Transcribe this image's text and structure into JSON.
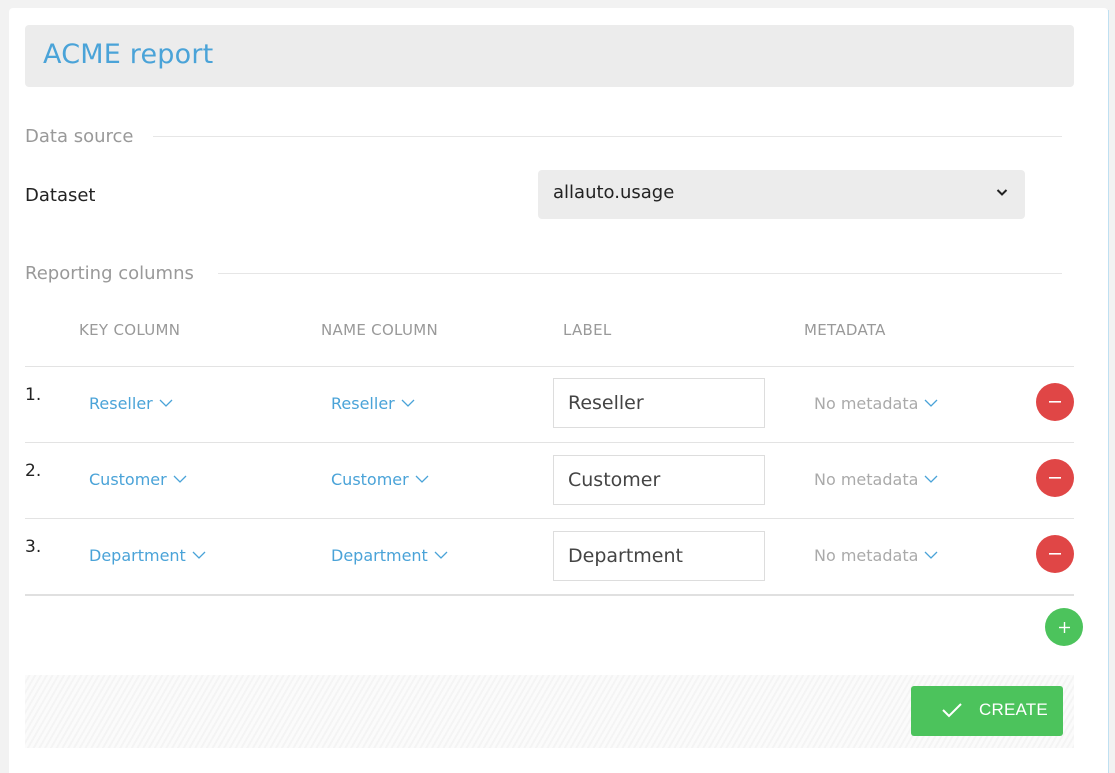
{
  "header": {
    "title": "ACME report"
  },
  "data_source": {
    "section_title": "Data source",
    "dataset_label": "Dataset",
    "dataset_value": "allauto.usage"
  },
  "reporting": {
    "section_title": "Reporting columns",
    "columns": {
      "key": "KEY COLUMN",
      "name": "NAME COLUMN",
      "label": "LABEL",
      "metadata": "METADATA"
    },
    "rows": [
      {
        "num": "1.",
        "key": "Reseller",
        "name": "Reseller",
        "label": "Reseller",
        "metadata": "No metadata"
      },
      {
        "num": "2.",
        "key": "Customer",
        "name": "Customer",
        "label": "Customer",
        "metadata": "No metadata"
      },
      {
        "num": "3.",
        "key": "Department",
        "name": "Department",
        "label": "Department",
        "metadata": "No metadata"
      }
    ]
  },
  "actions": {
    "add_icon": "plus-icon",
    "remove_icon": "minus-icon",
    "create_label": "CREATE",
    "create_icon": "check-icon"
  },
  "colors": {
    "accent": "#4aa3d8",
    "danger": "#e04646",
    "success": "#4cc35c"
  }
}
